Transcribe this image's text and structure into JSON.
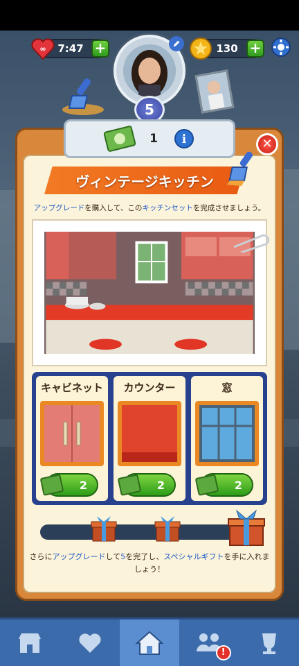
{
  "hud": {
    "lives_timer": "7:47",
    "lives_icon": "infinity-heart-icon",
    "coins": "130",
    "coin_icon": "star-coin-icon",
    "level": "5"
  },
  "popup": {
    "currency_count": "1",
    "title": "ヴィンテージキッチン",
    "description_parts": [
      "アップグレード",
      "を購入して、この",
      "キッチンセット",
      "を完成させましょう。"
    ],
    "items": [
      {
        "title": "キャビネット",
        "cost": "2",
        "kind": "cabinet"
      },
      {
        "title": "カウンター",
        "cost": "2",
        "kind": "counter"
      },
      {
        "title": "窓",
        "cost": "2",
        "kind": "window"
      }
    ],
    "footer_parts": [
      "さらに",
      "アップグレード",
      "して",
      "5",
      "を完了し、",
      "スペシャルギフト",
      "を手に入れましょう！"
    ]
  },
  "nav": {
    "items": [
      "shop-icon",
      "heart-icon",
      "home-icon",
      "friends-icon",
      "trophy-icon"
    ],
    "active": "home-icon",
    "friends_badge": "!"
  },
  "colors": {
    "popup_orange": "#d9873a",
    "ribbon": "#f27b24",
    "panel_blue": "#28418e",
    "green_button": "#2d9d18",
    "nav_blue": "#3c6bab"
  }
}
